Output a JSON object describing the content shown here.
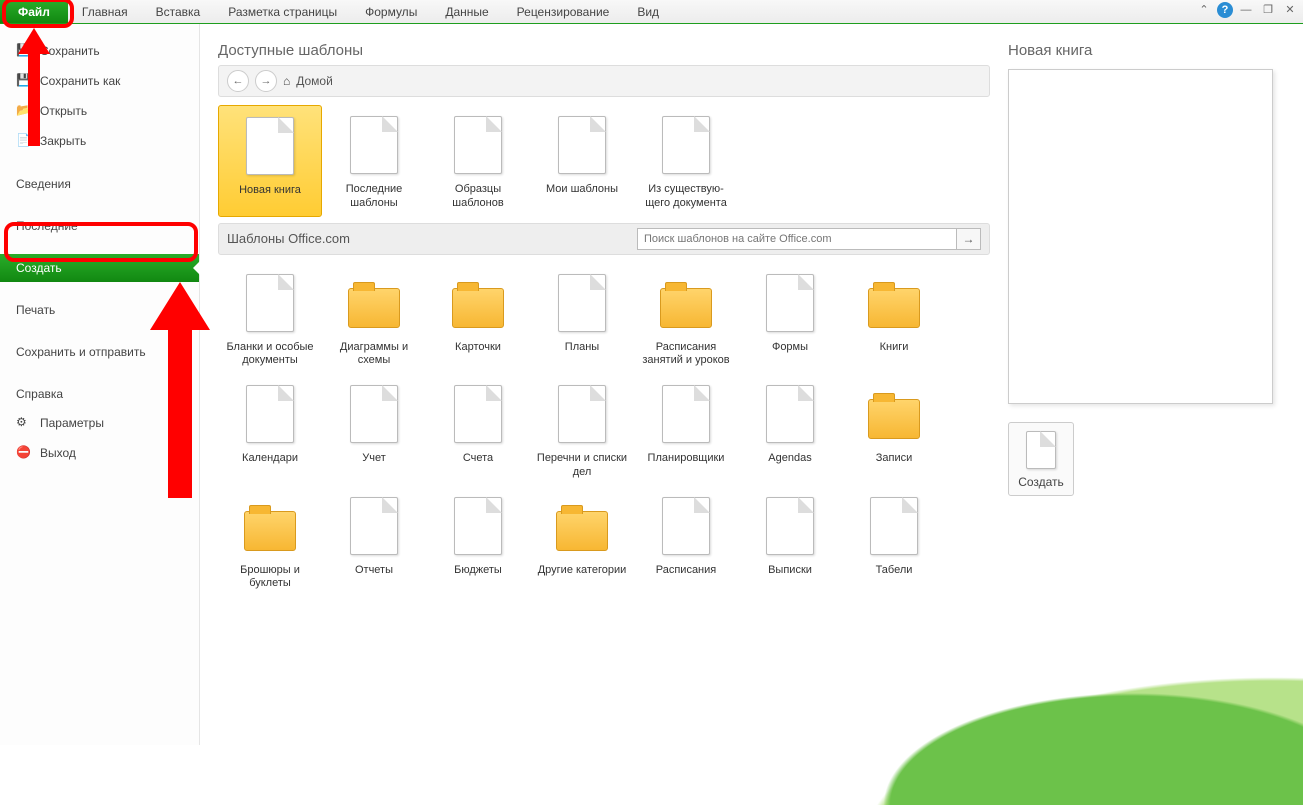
{
  "ribbon": {
    "tabs": [
      "Файл",
      "Главная",
      "Вставка",
      "Разметка страницы",
      "Формулы",
      "Данные",
      "Рецензирование",
      "Вид"
    ]
  },
  "sidebar": {
    "items": [
      {
        "label": "Сохранить",
        "icon": "save-icon"
      },
      {
        "label": "Сохранить как",
        "icon": "save-as-icon"
      },
      {
        "label": "Открыть",
        "icon": "open-icon"
      },
      {
        "label": "Закрыть",
        "icon": "close-file-icon"
      },
      {
        "label": "Сведения",
        "spaced": true
      },
      {
        "label": "Последние"
      },
      {
        "label": "Создать",
        "active": true
      },
      {
        "label": "Печать"
      },
      {
        "label": "Сохранить и отправить"
      },
      {
        "label": "Справка",
        "spaced": true
      },
      {
        "label": "Параметры",
        "icon": "options-icon"
      },
      {
        "label": "Выход",
        "icon": "exit-icon"
      }
    ]
  },
  "templates": {
    "title": "Доступные шаблоны",
    "breadcrumb": "Домой",
    "top": [
      {
        "label": "Новая книга",
        "icon": "file",
        "selected": true
      },
      {
        "label": "Последние шаблоны",
        "icon": "file"
      },
      {
        "label": "Образцы шаблонов",
        "icon": "file"
      },
      {
        "label": "Мои шаблоны",
        "icon": "file"
      },
      {
        "label": "Из существую-\nщего документа",
        "icon": "file"
      }
    ],
    "office_title": "Шаблоны Office.com",
    "search_placeholder": "Поиск шаблонов на сайте Office.com",
    "categories": [
      {
        "label": "Бланки и особые документы",
        "icon": "file"
      },
      {
        "label": "Диаграммы и схемы",
        "icon": "folder"
      },
      {
        "label": "Карточки",
        "icon": "folder"
      },
      {
        "label": "Планы",
        "icon": "file"
      },
      {
        "label": "Расписания занятий и уроков",
        "icon": "folder"
      },
      {
        "label": "Формы",
        "icon": "file"
      },
      {
        "label": "Книги",
        "icon": "folder"
      },
      {
        "label": "Календари",
        "icon": "file"
      },
      {
        "label": "Учет",
        "icon": "file"
      },
      {
        "label": "Счета",
        "icon": "file"
      },
      {
        "label": "Перечни и списки дел",
        "icon": "file"
      },
      {
        "label": "Планировщики",
        "icon": "file"
      },
      {
        "label": "Agendas",
        "icon": "file"
      },
      {
        "label": "Записи",
        "icon": "folder"
      },
      {
        "label": "Брошюры и буклеты",
        "icon": "folder"
      },
      {
        "label": "Отчеты",
        "icon": "file"
      },
      {
        "label": "Бюджеты",
        "icon": "file"
      },
      {
        "label": "Другие категории",
        "icon": "folder"
      },
      {
        "label": "Расписания",
        "icon": "file"
      },
      {
        "label": "Выписки",
        "icon": "file"
      },
      {
        "label": "Табели",
        "icon": "file"
      }
    ]
  },
  "preview": {
    "title": "Новая книга",
    "create_label": "Создать"
  }
}
